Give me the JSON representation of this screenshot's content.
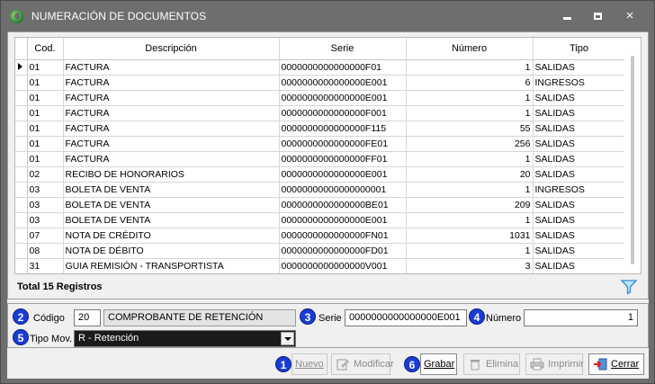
{
  "window": {
    "title": "NUMERACIÓN DE DOCUMENTOS",
    "controls": {
      "minimize": "minimize",
      "maximize": "maximize",
      "close": "×"
    }
  },
  "grid": {
    "columns": [
      "Cod.",
      "Descripción",
      "Serie",
      "Número",
      "Tipo"
    ],
    "rows": [
      [
        "01",
        "FACTURA",
        "0000000000000000F01",
        "1",
        "SALIDAS"
      ],
      [
        "01",
        "FACTURA",
        "0000000000000000E001",
        "6",
        "INGRESOS"
      ],
      [
        "01",
        "FACTURA",
        "0000000000000000E001",
        "1",
        "SALIDAS"
      ],
      [
        "01",
        "FACTURA",
        "0000000000000000F001",
        "1",
        "SALIDAS"
      ],
      [
        "01",
        "FACTURA",
        "0000000000000000F115",
        "55",
        "SALIDAS"
      ],
      [
        "01",
        "FACTURA",
        "0000000000000000FE01",
        "256",
        "SALIDAS"
      ],
      [
        "01",
        "FACTURA",
        "0000000000000000FF01",
        "1",
        "SALIDAS"
      ],
      [
        "02",
        "RECIBO DE HONORARIOS",
        "0000000000000000E001",
        "20",
        "SALIDAS"
      ],
      [
        "03",
        "BOLETA DE VENTA",
        "00000000000000000001",
        "1",
        "INGRESOS"
      ],
      [
        "03",
        "BOLETA DE VENTA",
        "0000000000000000BE01",
        "209",
        "SALIDAS"
      ],
      [
        "03",
        "BOLETA DE VENTA",
        "0000000000000000E001",
        "1",
        "SALIDAS"
      ],
      [
        "07",
        "NOTA DE CRÉDITO",
        "0000000000000000FN01",
        "1031",
        "SALIDAS"
      ],
      [
        "08",
        "NOTA DE DÉBITO",
        "0000000000000000FD01",
        "1",
        "SALIDAS"
      ],
      [
        "31",
        "GUIA REMISIÓN - TRANSPORTISTA",
        "0000000000000000V001",
        "3",
        "SALIDAS"
      ]
    ],
    "total_label": "Total 15 Registros"
  },
  "form": {
    "codigo_label": "Código",
    "codigo_value": "20",
    "codigo_desc": "COMPROBANTE DE RETENCIÓN",
    "serie_label": "Serie",
    "serie_value": "0000000000000000E001",
    "numero_label": "Número",
    "numero_value": "1",
    "tipo_label": "Tipo Mov.",
    "tipo_value": "R - Retención"
  },
  "badges": [
    "1",
    "2",
    "3",
    "4",
    "5",
    "6"
  ],
  "toolbar": {
    "nuevo": "Nuevo",
    "modificar": "Modificar",
    "grabar": "Grabar",
    "elimina": "Elimina",
    "imprimir": "Imprimir",
    "cerrar": "Cerrar"
  },
  "colors": {
    "titlebar": "#6e6e6e",
    "badge": "#1a3cd6",
    "dropdown_bg": "#1a1a1a"
  }
}
